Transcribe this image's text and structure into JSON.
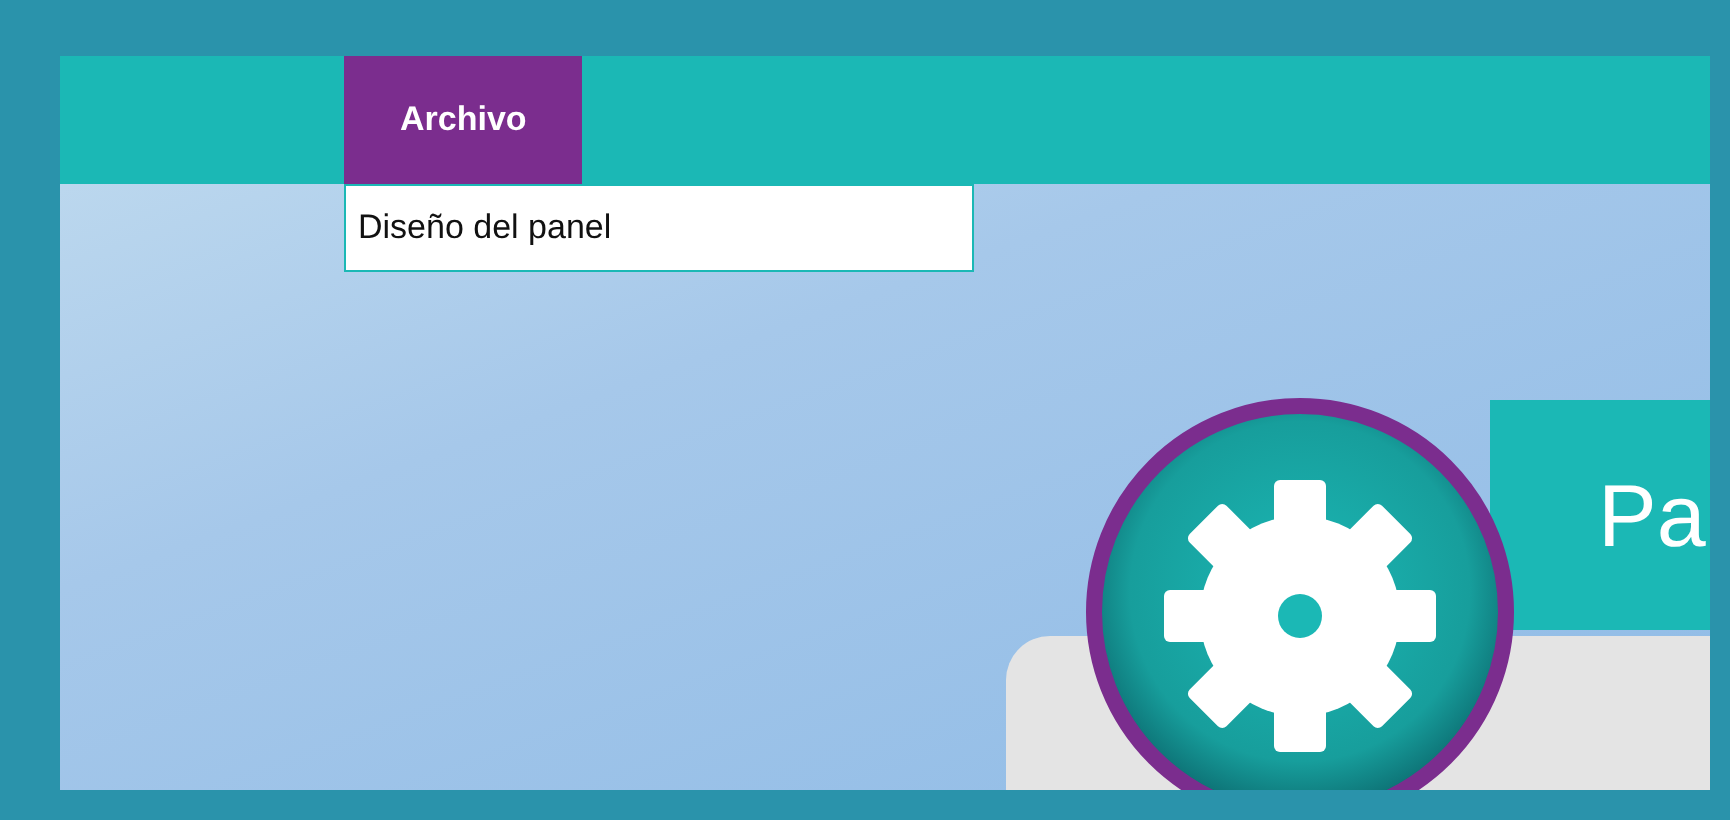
{
  "menu": [
    {
      "label": "Archivo",
      "selected": true,
      "expanded": true,
      "items": [
        {
          "label": "Diseño del panel"
        }
      ]
    }
  ],
  "panel": {
    "title": "Pa"
  }
}
